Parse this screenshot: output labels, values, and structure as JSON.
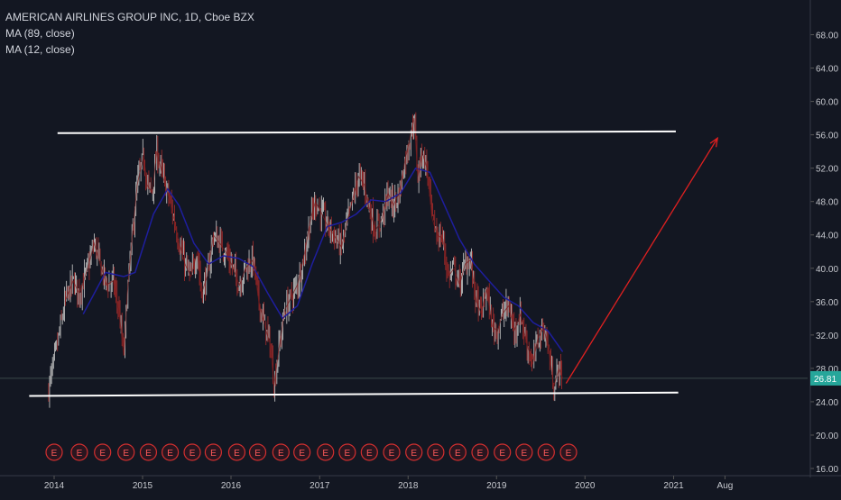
{
  "legend": {
    "title": "AMERICAN AIRLINES GROUP INC, 1D, Cboe BZX",
    "ma1": "MA (89, close)",
    "ma2": "MA (12, close)"
  },
  "colors": {
    "background": "#131722",
    "candle_up": "#bdbdbd",
    "candle_down": "#9a2a2a",
    "ma_slow": "#1e1e9e",
    "ma_fast": "#7a1a1a",
    "trendline": "#ffffff",
    "arrow": "#e02020",
    "price_badge": "#26a69a",
    "axis_text": "#c7c9cf",
    "earnings_marker": "#d32f2f"
  },
  "chart_data": {
    "type": "candlestick",
    "x_axis": {
      "tick_labels": [
        "2014",
        "2015",
        "2016",
        "2017",
        "2018",
        "2019",
        "2020",
        "2021",
        "Aug"
      ]
    },
    "y_axis": {
      "ylim": [
        16,
        70
      ],
      "tick_labels": [
        "16.00",
        "20.00",
        "24.00",
        "28.00",
        "32.00",
        "36.00",
        "40.00",
        "44.00",
        "48.00",
        "52.00",
        "56.00",
        "60.00",
        "64.00",
        "68.00"
      ]
    },
    "last_price": 26.81,
    "last_price_label": "26.81",
    "close_series": {
      "start": "2013-12",
      "end": "2019-10",
      "points": [
        [
          "2013-12-09",
          25.5
        ],
        [
          "2014-01-15",
          31
        ],
        [
          "2014-02-15",
          36
        ],
        [
          "2014-03-20",
          38.5
        ],
        [
          "2014-04-15",
          37
        ],
        [
          "2014-05-20",
          40
        ],
        [
          "2014-06-15",
          43
        ],
        [
          "2014-07-10",
          40.5
        ],
        [
          "2014-08-05",
          38
        ],
        [
          "2014-09-01",
          38.5
        ],
        [
          "2014-09-25",
          35
        ],
        [
          "2014-10-15",
          29.5
        ],
        [
          "2014-10-30",
          37
        ],
        [
          "2014-11-20",
          44
        ],
        [
          "2014-12-10",
          50
        ],
        [
          "2015-01-05",
          53.5
        ],
        [
          "2015-01-20",
          50
        ],
        [
          "2015-02-10",
          49
        ],
        [
          "2015-03-01",
          54
        ],
        [
          "2015-03-25",
          51
        ],
        [
          "2015-04-15",
          49
        ],
        [
          "2015-05-10",
          46
        ],
        [
          "2015-06-01",
          43
        ],
        [
          "2015-06-25",
          40.5
        ],
        [
          "2015-07-20",
          39
        ],
        [
          "2015-08-15",
          42
        ],
        [
          "2015-09-01",
          37
        ],
        [
          "2015-09-25",
          39
        ],
        [
          "2015-10-20",
          44
        ],
        [
          "2015-11-15",
          43
        ],
        [
          "2015-12-10",
          42
        ],
        [
          "2016-01-10",
          40
        ],
        [
          "2016-02-05",
          38
        ],
        [
          "2016-03-01",
          40
        ],
        [
          "2016-04-01",
          41
        ],
        [
          "2016-04-25",
          36
        ],
        [
          "2016-05-20",
          33
        ],
        [
          "2016-06-10",
          31
        ],
        [
          "2016-06-27",
          26
        ],
        [
          "2016-07-15",
          30
        ],
        [
          "2016-08-10",
          35
        ],
        [
          "2016-09-05",
          36.5
        ],
        [
          "2016-10-01",
          38
        ],
        [
          "2016-11-01",
          42
        ],
        [
          "2016-11-25",
          46
        ],
        [
          "2016-12-15",
          48
        ],
        [
          "2017-01-10",
          46.5
        ],
        [
          "2017-02-05",
          45
        ],
        [
          "2017-03-01",
          44
        ],
        [
          "2017-04-01",
          42.5
        ],
        [
          "2017-04-20",
          45
        ],
        [
          "2017-05-15",
          48
        ],
        [
          "2017-06-10",
          51
        ],
        [
          "2017-07-05",
          50
        ],
        [
          "2017-07-25",
          47
        ],
        [
          "2017-08-20",
          44.5
        ],
        [
          "2017-09-15",
          46
        ],
        [
          "2017-10-10",
          49
        ],
        [
          "2017-11-01",
          47.5
        ],
        [
          "2017-11-25",
          49
        ],
        [
          "2017-12-20",
          53
        ],
        [
          "2018-01-15",
          56.5
        ],
        [
          "2018-01-26",
          58
        ],
        [
          "2018-02-10",
          51
        ],
        [
          "2018-02-28",
          54
        ],
        [
          "2018-03-20",
          52
        ],
        [
          "2018-04-10",
          46
        ],
        [
          "2018-05-01",
          44
        ],
        [
          "2018-05-25",
          43.5
        ],
        [
          "2018-06-15",
          39
        ],
        [
          "2018-07-10",
          40
        ],
        [
          "2018-08-01",
          38
        ],
        [
          "2018-08-25",
          40.5
        ],
        [
          "2018-09-15",
          41
        ],
        [
          "2018-10-10",
          36
        ],
        [
          "2018-10-30",
          34.5
        ],
        [
          "2018-11-20",
          37.5
        ],
        [
          "2018-12-15",
          33
        ],
        [
          "2019-01-05",
          32.5
        ],
        [
          "2019-01-25",
          34.5
        ],
        [
          "2019-02-20",
          35.5
        ],
        [
          "2019-03-15",
          32.5
        ],
        [
          "2019-04-10",
          34.5
        ],
        [
          "2019-05-05",
          31
        ],
        [
          "2019-05-30",
          28.5
        ],
        [
          "2019-06-20",
          31.5
        ],
        [
          "2019-07-15",
          33
        ],
        [
          "2019-08-05",
          30
        ],
        [
          "2019-08-25",
          25.8
        ],
        [
          "2019-09-15",
          28
        ],
        [
          "2019-10-01",
          26.81
        ]
      ]
    },
    "ma_slow_points": [
      [
        "2014-05-01",
        34.5
      ],
      [
        "2014-08-01",
        39.5
      ],
      [
        "2014-10-15",
        39
      ],
      [
        "2014-12-01",
        39.5
      ],
      [
        "2015-02-15",
        46.5
      ],
      [
        "2015-04-15",
        49.5
      ],
      [
        "2015-06-01",
        47.5
      ],
      [
        "2015-08-01",
        43
      ],
      [
        "2015-10-01",
        40.5
      ],
      [
        "2015-12-01",
        41.5
      ],
      [
        "2016-02-01",
        41.2
      ],
      [
        "2016-04-01",
        40.2
      ],
      [
        "2016-06-01",
        37
      ],
      [
        "2016-08-01",
        34
      ],
      [
        "2016-10-01",
        35.5
      ],
      [
        "2016-12-01",
        40.5
      ],
      [
        "2017-02-01",
        45
      ],
      [
        "2017-04-01",
        45.5
      ],
      [
        "2017-06-01",
        46.5
      ],
      [
        "2017-08-01",
        48.2
      ],
      [
        "2017-10-01",
        48
      ],
      [
        "2017-12-01",
        49
      ],
      [
        "2018-02-01",
        52
      ],
      [
        "2018-04-01",
        51.5
      ],
      [
        "2018-06-01",
        47.5
      ],
      [
        "2018-08-01",
        43.5
      ],
      [
        "2018-10-01",
        40.5
      ],
      [
        "2018-12-01",
        38.5
      ],
      [
        "2019-02-01",
        36.5
      ],
      [
        "2019-04-01",
        35.5
      ],
      [
        "2019-06-01",
        33.5
      ],
      [
        "2019-08-01",
        32.5
      ],
      [
        "2019-10-01",
        30
      ]
    ],
    "trendlines": [
      {
        "name": "resistance",
        "start": [
          "2014-01-15",
          56.2
        ],
        "end": [
          "2021-01-10",
          56.4
        ]
      },
      {
        "name": "support",
        "start": [
          "2013-09-20",
          24.7
        ],
        "end": [
          "2021-01-20",
          25.1
        ]
      }
    ],
    "projection_arrow": {
      "start": [
        "2019-10-15",
        26.2
      ],
      "end": [
        "2021-07-01",
        55.6
      ]
    },
    "earnings_markers": {
      "label": "E",
      "dates": [
        "2014-01-01",
        "2014-04-15",
        "2014-07-20",
        "2014-10-25",
        "2015-01-25",
        "2015-04-25",
        "2015-07-25",
        "2015-10-20",
        "2016-01-25",
        "2016-04-20",
        "2016-07-25",
        "2016-10-20",
        "2017-01-25",
        "2017-04-25",
        "2017-07-25",
        "2017-10-25",
        "2018-01-25",
        "2018-04-25",
        "2018-07-25",
        "2018-10-25",
        "2019-01-25",
        "2019-04-25",
        "2019-07-25",
        "2019-10-25"
      ]
    }
  }
}
